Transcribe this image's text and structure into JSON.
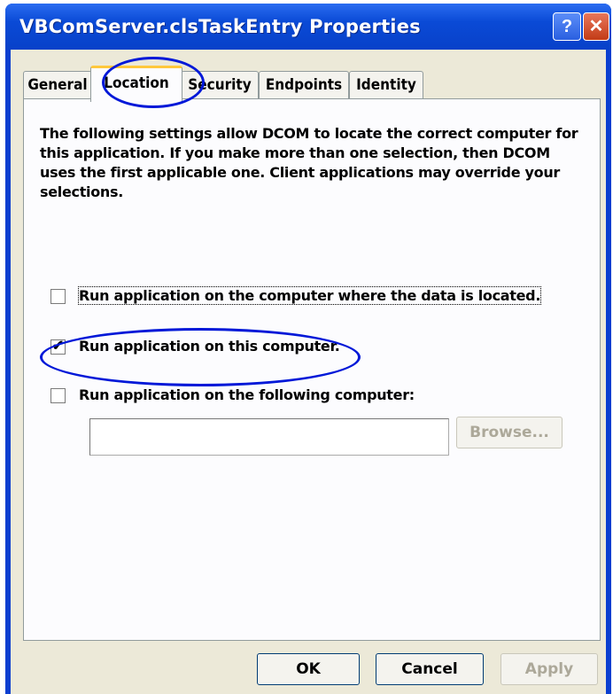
{
  "window": {
    "title": "VBComServer.clsTaskEntry Properties",
    "help_label": "?",
    "close_label": "✕"
  },
  "tabs": [
    {
      "label": "General"
    },
    {
      "label": "Location"
    },
    {
      "label": "Security"
    },
    {
      "label": "Endpoints"
    },
    {
      "label": "Identity"
    }
  ],
  "active_tab": "Location",
  "description": "The following settings allow DCOM to locate the correct computer for this application. If you make more than one selection, then DCOM uses the first applicable one. Client applications may override your selections.",
  "options": [
    {
      "label": "Run application on the computer where the data is located.",
      "checked": false,
      "mark": ""
    },
    {
      "label": "Run application on this computer.",
      "checked": true,
      "mark": "✔"
    },
    {
      "label": "Run application on the following computer:",
      "checked": false,
      "mark": ""
    }
  ],
  "computer_input": {
    "value": ""
  },
  "buttons": {
    "browse": "Browse...",
    "ok": "OK",
    "cancel": "Cancel",
    "apply": "Apply"
  },
  "colors": {
    "titlebar": "#0a4ad6",
    "highlight_circle": "#0018d8",
    "dialog_bg": "#ece9d8"
  }
}
